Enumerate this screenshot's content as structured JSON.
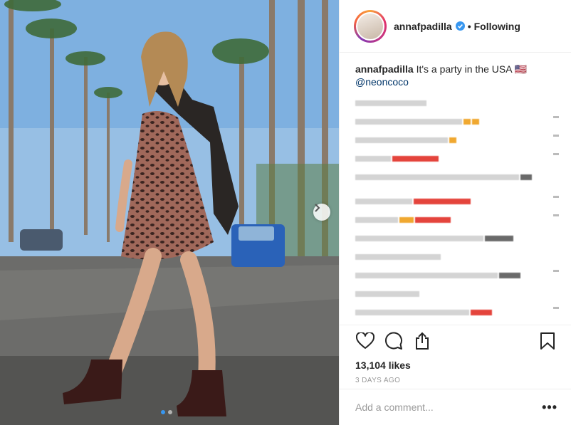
{
  "post": {
    "username": "annafpadilla",
    "follow_status": "Following",
    "separator": "•",
    "caption_text": "It's a party in the USA 🇺🇸",
    "mention": "@neoncoco",
    "likes": "13,104 likes",
    "timestamp": "3 DAYS AGO",
    "comment_placeholder": "Add a comment...",
    "more_options": "•••"
  },
  "carousel": {
    "current": 1,
    "total": 2
  },
  "colors": {
    "accent": "#3897f0",
    "verified": "#3897f0",
    "text": "#262626",
    "muted": "#999999",
    "border": "#efefef"
  },
  "icons": [
    "verified-badge-icon",
    "chevron-right-icon",
    "heart-icon",
    "comment-icon",
    "share-icon",
    "bookmark-icon",
    "more-options-icon"
  ]
}
